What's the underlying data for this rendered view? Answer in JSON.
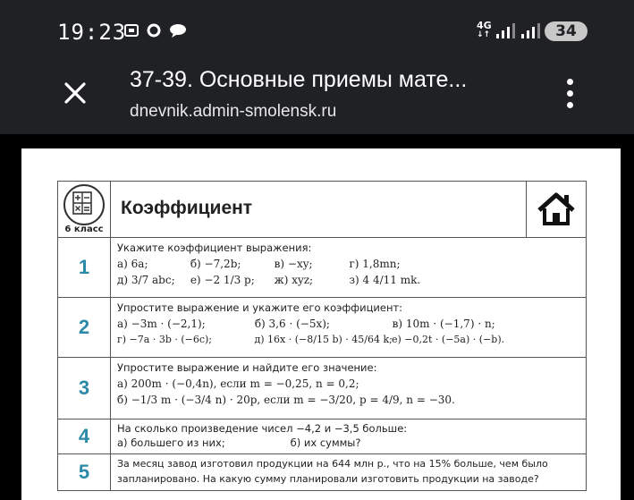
{
  "status": {
    "time": "19:23",
    "network": "4G",
    "battery": "34",
    "icons": [
      "screenshot-icon",
      "circle-icon",
      "chat-bubble-icon",
      "signal-icon",
      "signal-icon"
    ]
  },
  "appbar": {
    "title": "37-39. Основные приемы мате...",
    "url": "dnevnik.admin-smolensk.ru"
  },
  "document": {
    "header": {
      "grade": "6 класс",
      "title": "Коэффициент"
    },
    "accent_color": "#2a8aa8",
    "tasks": [
      {
        "number": "1",
        "question": "Укажите коэффициент выражения:",
        "lines": [
          [
            "а) 6a;",
            "б) −7,2b;",
            "в) −xy;",
            "г) 1,8mn;"
          ],
          [
            "д) 3/7 abc;",
            "е) −2 1/3 p;",
            "ж) xyz;",
            "з) 4 4/11 mk."
          ]
        ]
      },
      {
        "number": "2",
        "question": "Упростите выражение и укажите его коэффициент:",
        "lines": [
          [
            "а) −3m · (−2,1);",
            "б) 3,6 · (−5x);",
            "в) 10m · (−1,7) · n;"
          ],
          [
            "г) −7a · 3b · (−6c);",
            "д) 16x · (−8/15 b) · 45/64 k;",
            "е) −0,2t · (−5a) · (−b)."
          ]
        ]
      },
      {
        "number": "3",
        "question": "Упростите выражение и найдите его значение:",
        "lines": [
          [
            "а) 200m · (−0,4n), если m = −0,25, n = 0,2;"
          ],
          [
            "б) −1/3 m · (−3/4 n) · 20p, если m = −3/20, p = 4/9, n = −30."
          ]
        ]
      },
      {
        "number": "4",
        "question": "На сколько произведение чисел −4,2 и −3,5 больше:",
        "lines": [
          [
            "а) большего из них;",
            "б) их суммы?"
          ]
        ]
      },
      {
        "number": "5",
        "question": "За месяц завод изготовил продукции на 644 млн р., что на 15% больше, чем было",
        "lines": [
          [
            "запланировано. На какую сумму планировали изготовить продукции на заводе?"
          ]
        ]
      }
    ]
  }
}
